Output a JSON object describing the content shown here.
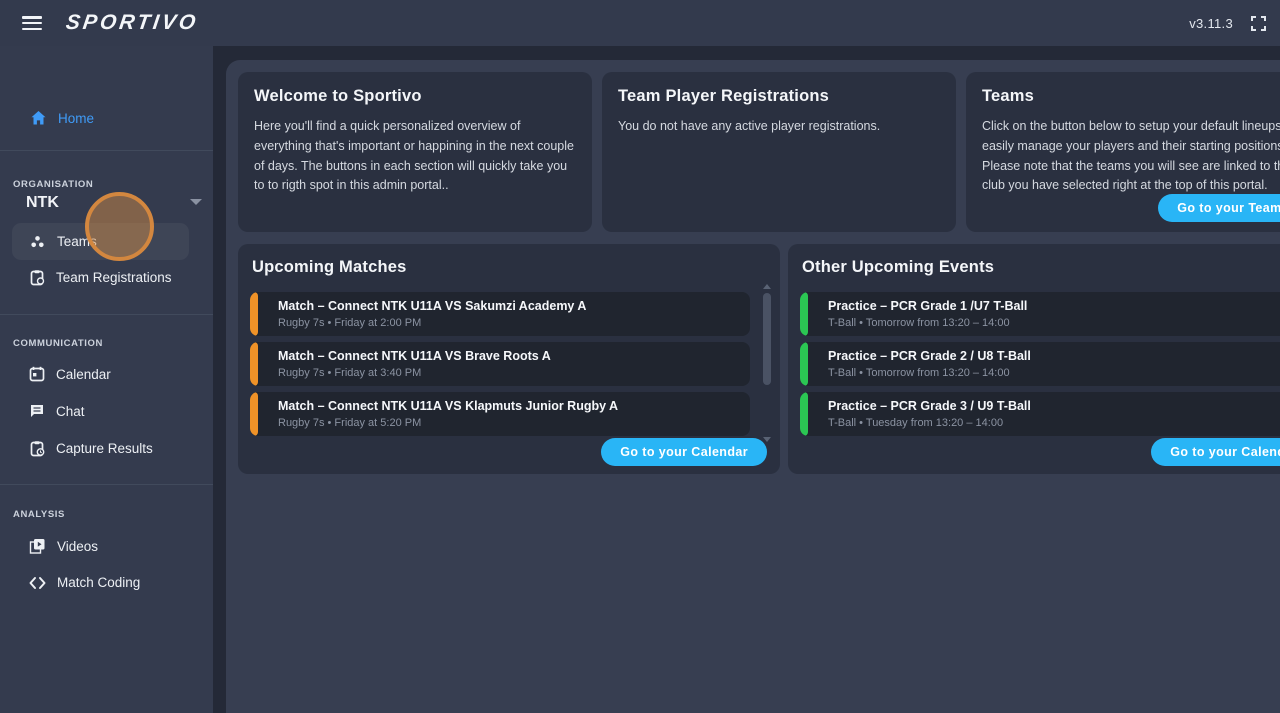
{
  "topbar": {
    "logo": "SPORTIVO",
    "version": "v3.11.3"
  },
  "sidebar": {
    "home": {
      "label": "Home"
    },
    "org": {
      "section_label": "ORGANISATION",
      "org_name": "NTK",
      "items": [
        {
          "label": "Teams"
        },
        {
          "label": "Team Registrations"
        }
      ]
    },
    "comm": {
      "section_label": "COMMUNICATION",
      "items": [
        {
          "label": "Calendar"
        },
        {
          "label": "Chat"
        },
        {
          "label": "Capture Results"
        }
      ]
    },
    "analysis": {
      "section_label": "ANALYSIS",
      "items": [
        {
          "label": "Videos"
        },
        {
          "label": "Match Coding"
        }
      ]
    }
  },
  "cards": {
    "welcome": {
      "title": "Welcome to Sportivo",
      "body": "Here you'll find a quick personalized overview of everything that's important or happining in the next couple of days. The buttons in each section will quickly take you to to rigth spot in this admin portal.."
    },
    "registrations": {
      "title": "Team Player Registrations",
      "body": "You do not have any active player registrations."
    },
    "teams": {
      "title": "Teams",
      "body": "Click on the button below to setup your default lineups and easily manage your players and their starting positions. Please note that the teams you will see are linked to the club you have selected right at the top of this portal.",
      "button": "Go to your Teams"
    }
  },
  "matches": {
    "title": "Upcoming Matches",
    "items": [
      {
        "title": "Match – Connect NTK U11A VS Sakumzi Academy A",
        "subtitle": "Rugby 7s • Friday at 2:00 PM"
      },
      {
        "title": "Match – Connect NTK U11A VS Brave Roots A",
        "subtitle": "Rugby 7s • Friday at 3:40 PM"
      },
      {
        "title": "Match – Connect NTK U11A VS Klapmuts Junior Rugby A",
        "subtitle": "Rugby 7s • Friday at 5:20 PM"
      }
    ],
    "button": "Go to your Calendar"
  },
  "events": {
    "title": "Other Upcoming Events",
    "items": [
      {
        "title": "Practice – PCR Grade 1 /U7 T-Ball",
        "subtitle": "T-Ball • Tomorrow from 13:20 – 14:00"
      },
      {
        "title": "Practice – PCR Grade 2 / U8 T-Ball",
        "subtitle": "T-Ball • Tomorrow from 13:20 – 14:00"
      },
      {
        "title": "Practice – PCR Grade 3 / U9 T-Ball",
        "subtitle": "T-Ball • Tuesday from 13:20 – 14:00"
      }
    ],
    "button": "Go to your Calendar"
  },
  "colors": {
    "topbar_bg": "#333a4d",
    "sidebar_bg": "#343b4e",
    "app_bg": "#242937",
    "panel_bg": "#373e51",
    "card_bg": "#2a3040",
    "item_bg": "#20252f",
    "accent_orange": "#ef9228",
    "accent_green": "#2bc653",
    "accent_cyan": "#29b5f6",
    "home_blue": "#3f9bf7",
    "highlight_circle": "#d3873f"
  }
}
